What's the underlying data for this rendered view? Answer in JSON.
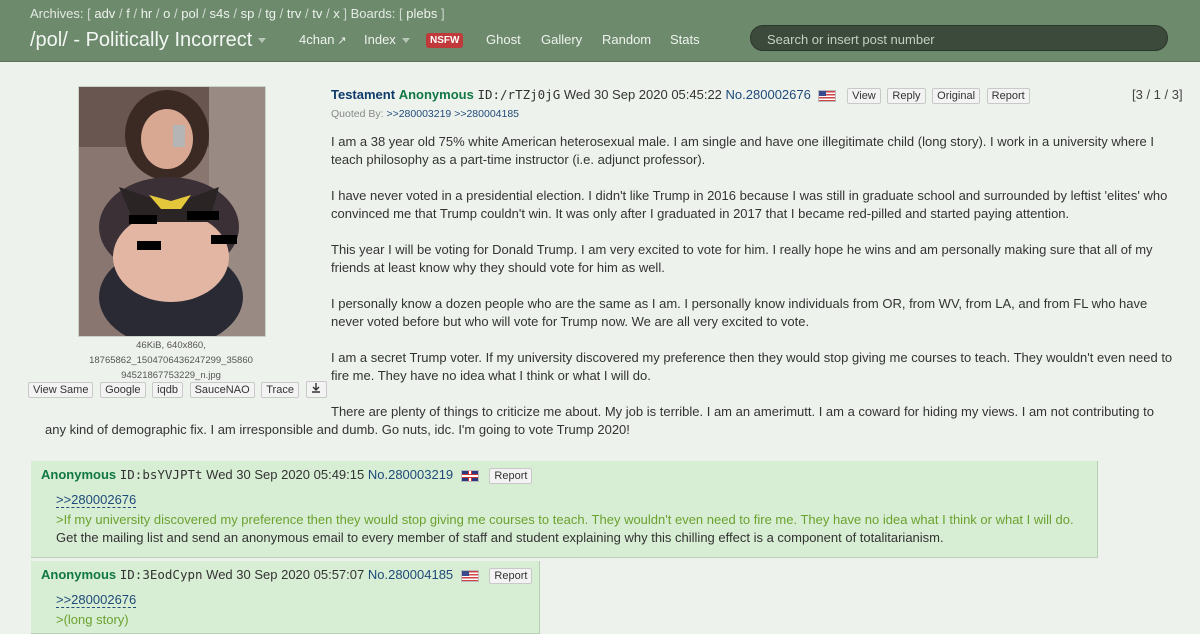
{
  "header": {
    "archives_label": "Archives:",
    "archives": [
      "adv",
      "f",
      "hr",
      "o",
      "pol",
      "s4s",
      "sp",
      "tg",
      "trv",
      "tv",
      "x"
    ],
    "boards_label": "Boards:",
    "boards": [
      "plebs"
    ],
    "board_title": "/pol/ - Politically Incorrect",
    "nav": {
      "fourchan": "4chan",
      "index": "Index",
      "nsfw": "NSFW",
      "ghost": "Ghost",
      "gallery": "Gallery",
      "random": "Random",
      "stats": "Stats"
    },
    "search_placeholder": "Search or insert post number",
    "colors": {
      "bar": "#6d8a6d",
      "nsfw_badge": "#c0393b",
      "search_bg": "#3c4a3c"
    }
  },
  "op": {
    "file": {
      "info_line1": "46KiB, 640x860,",
      "info_line2": "18765862_1504706436247299_35860",
      "info_line3": "94521867753229_n.jpg",
      "buttons": [
        "View Same",
        "Google",
        "iqdb",
        "SauceNAO",
        "Trace"
      ],
      "download_icon": "download-icon"
    },
    "title": "Testament",
    "name": "Anonymous",
    "poster_id": "ID:/rTZj0jG",
    "datetime": "Wed 30 Sep 2020 05:45:22",
    "post_no": "No.280002676",
    "flag": "us-flag-icon",
    "buttons": [
      "View",
      "Reply",
      "Original",
      "Report"
    ],
    "counts": "[3 / 1 / 3]",
    "quoted_by_label": "Quoted By:",
    "quoted_by": [
      ">>280003219",
      ">>280004185"
    ],
    "body": {
      "p1": "I am a 38 year old 75% white American heterosexual male. I am single and have one illegitimate child (long story). I work in a university where I teach philosophy as a part-time instructor (i.e. adjunct professor).",
      "p2": "I have never voted in a presidential election. I didn't like Trump in 2016 because I was still in graduate school and surrounded by leftist 'elites' who convinced me that Trump couldn't win. It was only after I graduated in 2017 that I became red-pilled and started paying attention.",
      "p3": "This year I will be voting for Donald Trump. I am very excited to vote for him. I really hope he wins and am personally making sure that all of my friends at least know why they should vote for him as well.",
      "p4": "I personally know a dozen people who are the same as I am. I personally know individuals from OR, from WV, from LA, and from FL who have never voted before but who will vote for Trump now. We are all very excited to vote.",
      "p5": "I am a secret Trump voter. If my university discovered my preference then they would stop giving me courses to teach. They wouldn't even need to fire me. They have no idea what I think or what I will do.",
      "p6a": "There are plenty of things to criticize me about. My job is terrible. I am an amerimutt. I am a coward for hiding my views. I am not contributing to",
      "p6b": "any kind of demographic fix. I am irresponsible and dumb. Go nuts, idc. I'm going to vote Trump 2020!"
    }
  },
  "replies": [
    {
      "name": "Anonymous",
      "poster_id": "ID:bsYVJPTt",
      "datetime": "Wed 30 Sep 2020 05:49:15",
      "post_no": "No.280003219",
      "flag": "gb-flag-icon",
      "report": "Report",
      "quote_link": ">>280002676",
      "greentext": ">If my university discovered my preference then they would stop giving me courses to teach. They wouldn't even need to fire me. They have no idea what I think or what I will do.",
      "text": "Get the mailing list and send an anonymous email to every member of staff and student explaining why this chilling effect is a component of totalitarianism."
    },
    {
      "name": "Anonymous",
      "poster_id": "ID:3EodCypn",
      "datetime": "Wed 30 Sep 2020 05:57:07",
      "post_no": "No.280004185",
      "flag": "us-flag-icon",
      "report": "Report",
      "quote_link": ">>280002676",
      "greentext": ">(long story)"
    }
  ]
}
